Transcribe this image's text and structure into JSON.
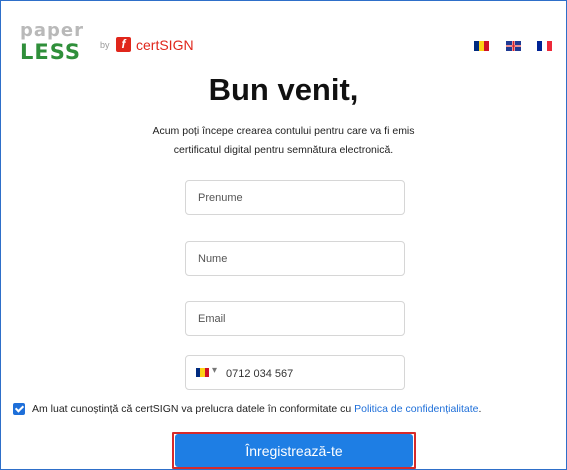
{
  "logo": {
    "top": "paper",
    "bottom": "LESS",
    "by": "by",
    "partner_mark": "f",
    "partner": "certSIGN"
  },
  "languages": [
    {
      "code": "ro",
      "colors": [
        "#002b7f",
        "#fcd116",
        "#ce1126"
      ]
    },
    {
      "code": "en",
      "colors": [
        "#1f3a93",
        "#ffffff",
        "#d8232a"
      ]
    },
    {
      "code": "fr",
      "colors": [
        "#002395",
        "#ffffff",
        "#ed2939"
      ]
    }
  ],
  "heading": "Bun venit,",
  "intro": {
    "line1": "Acum poți începe crearea contului pentru care va fi emis",
    "line2": "certificatul digital pentru semnătura electronică."
  },
  "form": {
    "first_name_placeholder": "Prenume",
    "last_name_placeholder": "Nume",
    "email_placeholder": "Email",
    "phone_value": "0712 034 567",
    "phone_caret": "▾",
    "consent_checked": true,
    "consent_text": "Am luat cunoștință că certSIGN va prelucra datele în conformitate cu ",
    "consent_link": "Politica de confidențialitate",
    "consent_end": ".",
    "submit_label": "Înregistrează-te"
  },
  "colors": {
    "accent": "#1e7ee4",
    "logo_green": "#2f8f3a",
    "brand_red": "#e0261b",
    "highlight": "#d62a2a"
  }
}
